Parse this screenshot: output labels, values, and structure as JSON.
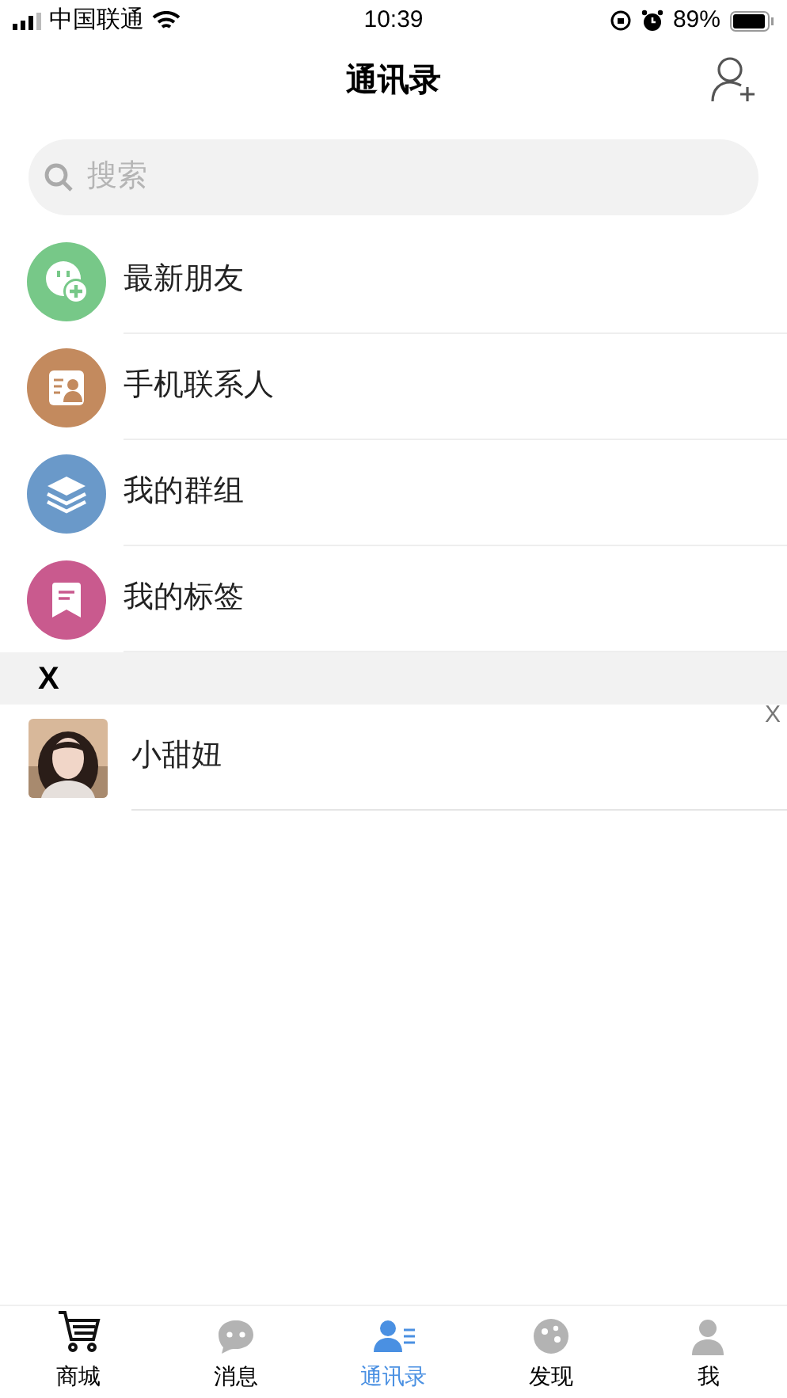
{
  "status_bar": {
    "carrier": "中国联通",
    "time": "10:39",
    "battery": "89%"
  },
  "header": {
    "title": "通讯录"
  },
  "search": {
    "placeholder": "搜索"
  },
  "menu": [
    {
      "kind": "new-friends",
      "label": "最新朋友",
      "color": "#77c888"
    },
    {
      "kind": "phone-contacts",
      "label": "手机联系人",
      "color": "#c38a5e"
    },
    {
      "kind": "groups",
      "label": "我的群组",
      "color": "#6a99c9"
    },
    {
      "kind": "tags",
      "label": "我的标签",
      "color": "#c95a8e"
    }
  ],
  "sections": [
    {
      "letter": "X",
      "contacts": [
        {
          "name": "小甜妞"
        }
      ]
    }
  ],
  "index_bar": [
    "X"
  ],
  "tabs": [
    {
      "kind": "cart",
      "label": "商城",
      "selected": false
    },
    {
      "kind": "chat",
      "label": "消息",
      "selected": false
    },
    {
      "kind": "contacts",
      "label": "通讯录",
      "selected": true
    },
    {
      "kind": "discover",
      "label": "发现",
      "selected": false
    },
    {
      "kind": "me",
      "label": "我",
      "selected": false
    }
  ]
}
